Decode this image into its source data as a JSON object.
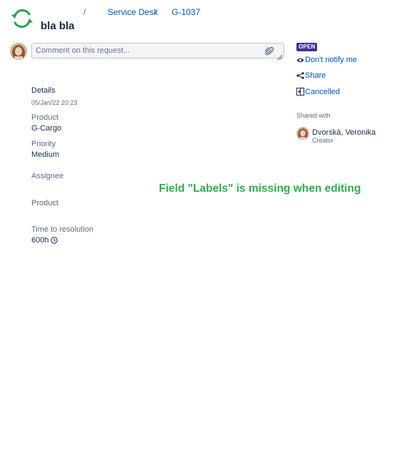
{
  "header": {
    "breadcrumb": {
      "separator": "/",
      "project": "Service Desk",
      "issue_key": "G-1037"
    },
    "title": "bla bla"
  },
  "comment": {
    "placeholder": "Comment on this request..."
  },
  "details": {
    "heading": "Details",
    "date": "05/Jan/22 20:23",
    "fields": {
      "product_label": "Product",
      "product_value": "G-Cargo",
      "priority_label": "Priority",
      "priority_value": "Medium",
      "assignee_label": "Assignee",
      "product2_label": "Product",
      "time_label": "Time to resolution",
      "time_value": "600h"
    }
  },
  "sidebar": {
    "status": "OPEN",
    "notify_label": "Don't notify me",
    "share_label": "Share",
    "resolution_label": "Cancelled",
    "shared_with_label": "Shared with",
    "person_name": "Dvorská, Veronika",
    "person_role": "Creator"
  },
  "annotation": {
    "text": "Field \"Labels\" is missing when editing"
  },
  "colors": {
    "link": "#0052cc",
    "status": "#403294",
    "annotation": "#2db14f",
    "logo": "#2aa150"
  }
}
